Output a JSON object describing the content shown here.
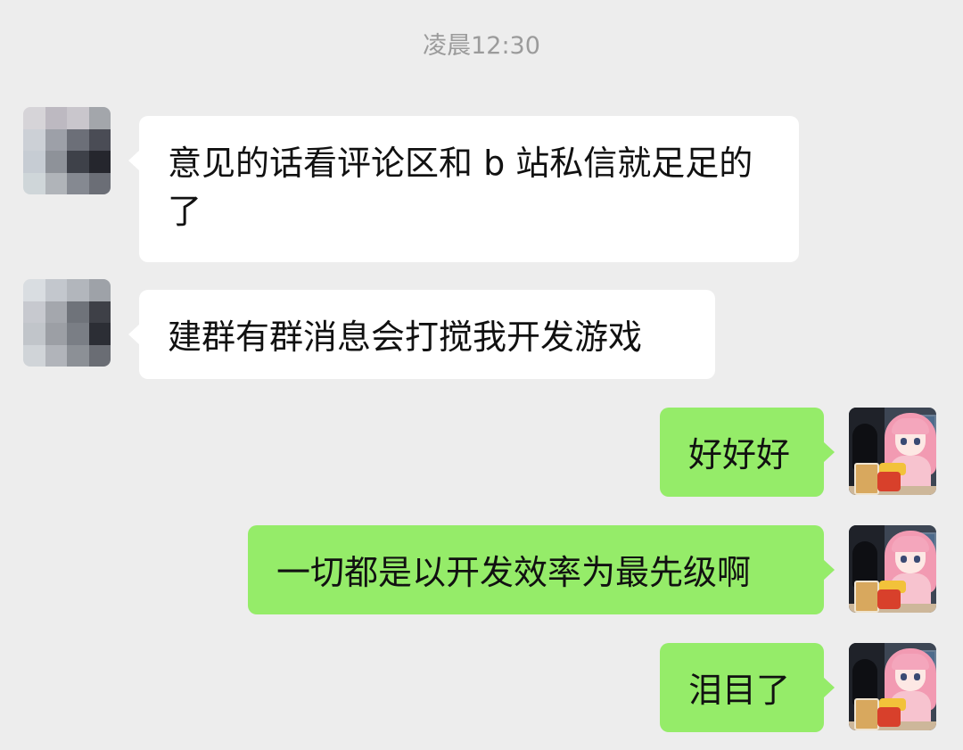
{
  "timestamp": "凌晨12:30",
  "messages": [
    {
      "side": "in",
      "text": "意见的话看评论区和 b 站私信就足足的了"
    },
    {
      "side": "in",
      "text": "建群有群消息会打搅我开发游戏"
    },
    {
      "side": "out",
      "text": "好好好"
    },
    {
      "side": "out",
      "text": "一切都是以开发效率为最先级啊"
    },
    {
      "side": "out",
      "text": "泪目了"
    }
  ],
  "colors": {
    "background": "#ededed",
    "incoming_bubble": "#ffffff",
    "outgoing_bubble": "#95ec69",
    "timestamp_text": "#9b9b9b"
  },
  "icons": {
    "contact_avatar": "pixelated-avatar-icon",
    "user_avatar": "anime-girl-avatar-icon"
  }
}
